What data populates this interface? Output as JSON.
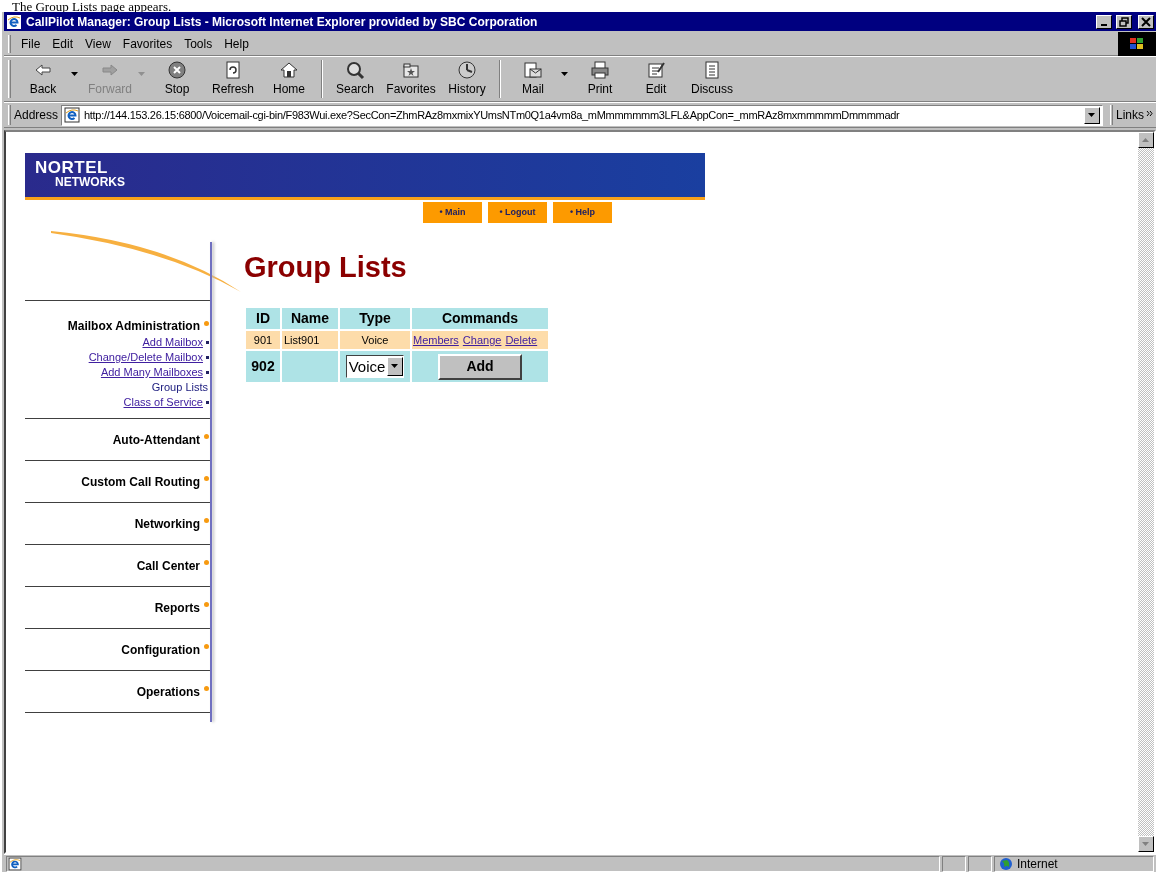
{
  "caption": "The Group Lists page appears.",
  "window": {
    "title": "CallPilot Manager: Group Lists - Microsoft Internet Explorer provided by SBC Corporation"
  },
  "menu": [
    "File",
    "Edit",
    "View",
    "Favorites",
    "Tools",
    "Help"
  ],
  "toolbar": [
    {
      "kind": "back",
      "label": "Back",
      "disabled": false,
      "dropdown": true,
      "separator": false
    },
    {
      "kind": "forward",
      "label": "Forward",
      "disabled": true,
      "dropdown": true,
      "separator": false
    },
    {
      "kind": "stop",
      "label": "Stop",
      "disabled": false,
      "dropdown": false,
      "separator": false
    },
    {
      "kind": "refresh",
      "label": "Refresh",
      "disabled": false,
      "dropdown": false,
      "separator": false
    },
    {
      "kind": "home",
      "label": "Home",
      "disabled": false,
      "dropdown": false,
      "separator": false
    },
    {
      "kind": "search",
      "label": "Search",
      "disabled": false,
      "dropdown": false,
      "separator": true
    },
    {
      "kind": "favorites",
      "label": "Favorites",
      "disabled": false,
      "dropdown": false,
      "separator": false
    },
    {
      "kind": "history",
      "label": "History",
      "disabled": false,
      "dropdown": false,
      "separator": false
    },
    {
      "kind": "mail",
      "label": "Mail",
      "disabled": false,
      "dropdown": true,
      "separator": true
    },
    {
      "kind": "print",
      "label": "Print",
      "disabled": false,
      "dropdown": false,
      "separator": false
    },
    {
      "kind": "edit",
      "label": "Edit",
      "disabled": false,
      "dropdown": false,
      "separator": false
    },
    {
      "kind": "discuss",
      "label": "Discuss",
      "disabled": false,
      "dropdown": false,
      "separator": false
    }
  ],
  "address": {
    "label": "Address",
    "url": "http://144.153.26.15:6800/Voicemail-cgi-bin/F983Wui.exe?SecCon=ZhmRAz8mxmixYUmsNTm0Q1a4vm8a_mMmmmmmm3LFL&AppCon=_mmRAz8mxmmmmmDmmmmadr",
    "links": "Links"
  },
  "page": {
    "logo": {
      "line1": "NORTEL",
      "line2": "NETWORKS"
    },
    "nav_buttons": [
      "• Main",
      "• Logout",
      "• Help"
    ],
    "heading": "Group Lists",
    "sidebar": [
      {
        "label": "Mailbox Administration",
        "items": [
          {
            "label": "Add Mailbox",
            "selected": false
          },
          {
            "label": "Change/Delete Mailbox",
            "selected": false
          },
          {
            "label": "Add Many Mailboxes",
            "selected": false
          },
          {
            "label": "Group Lists",
            "selected": true
          },
          {
            "label": "Class of Service",
            "selected": false
          }
        ]
      },
      {
        "label": "Auto-Attendant"
      },
      {
        "label": "Custom Call Routing"
      },
      {
        "label": "Networking"
      },
      {
        "label": "Call Center"
      },
      {
        "label": "Reports"
      },
      {
        "label": "Configuration"
      },
      {
        "label": "Operations"
      }
    ],
    "table": {
      "columns": [
        "ID",
        "Name",
        "Type",
        "Commands"
      ],
      "rows": [
        {
          "id": "901",
          "name": "List901",
          "type": "Voice",
          "commands": [
            "Members",
            "Change",
            "Delete"
          ]
        }
      ],
      "new_row": {
        "id": "902",
        "type": "Voice",
        "button": "Add"
      }
    }
  },
  "status_bar": {
    "zone": "Internet"
  }
}
